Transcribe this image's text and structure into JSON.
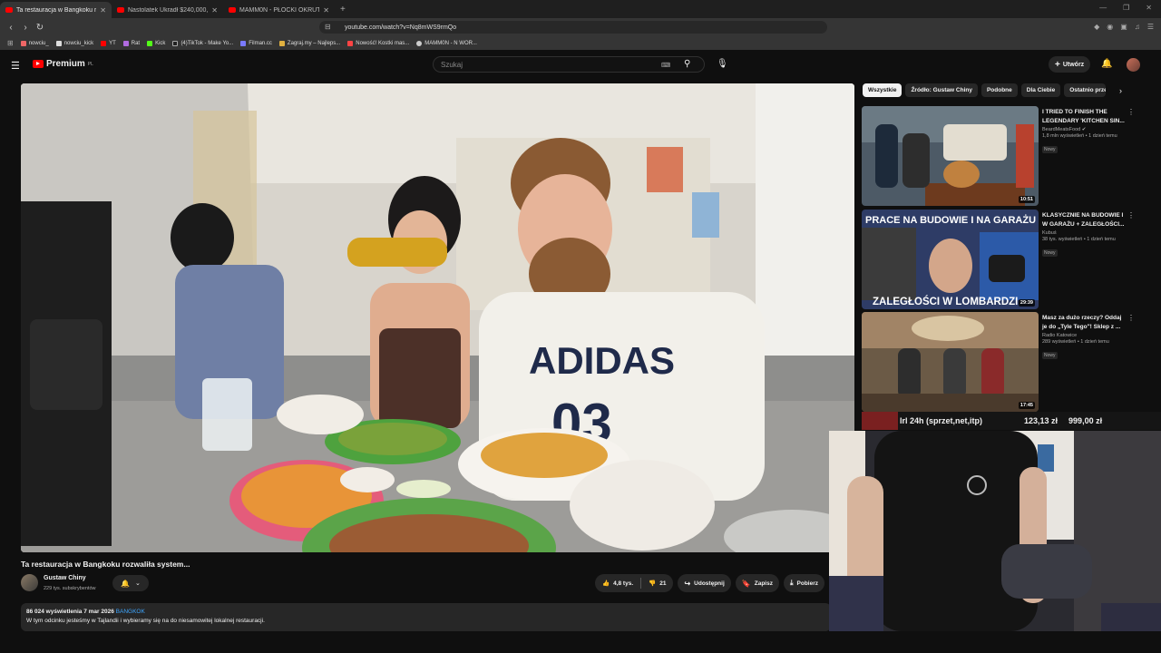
{
  "browser": {
    "tabs": [
      {
        "title": "Ta restauracja w Bangkoku ro",
        "active": true
      },
      {
        "title": "Nastolatek Ukradł $240,000,000 | Po",
        "active": false
      },
      {
        "title": "MAMM0N - PŁOCKI OKRUTNIK PUB",
        "active": false
      }
    ],
    "new_tab": "+",
    "url": "youtube.com/watch?v=Nq8mWS9rmQo",
    "bookmarks": [
      "nowciu_",
      "nowciu_kick",
      "YT",
      "Rat",
      "Kick",
      "(4)TikTok - Make Yo...",
      "Filman.cc",
      "Zagraj.my – Najleps...",
      "Nowość! Kostki mas...",
      "MAMM0N - N WOR..."
    ]
  },
  "youtube": {
    "logo": "Premium",
    "logo_region": "PL",
    "search_placeholder": "Szukaj",
    "create_label": "Utwórz"
  },
  "video": {
    "title": "Ta restauracja w Bangkoku rozwaliła system...",
    "channel": "Gustaw Chiny",
    "subscribers": "229 tys. subskrybentów",
    "likes": "4,8 tys.",
    "dislikes": "21",
    "share_label": "Udostępnij",
    "save_label": "Zapisz",
    "download_label": "Pobierz",
    "views_date": "86 024 wyświetlenia  7 mar 2026",
    "hashtag": "BANGKOK",
    "description": "W tym odcinku jesteśmy w Tajlandii i wybieramy się na do niesamowitej lokalnej restauracji."
  },
  "sidebar": {
    "chips": [
      "Wszystkie",
      "Źródło: Gustaw Chiny",
      "Podobne",
      "Dla Ciebie",
      "Ostatnio prze"
    ],
    "recommendations": [
      {
        "title": "I TRIED TO FINISH THE LEGENDARY 'KITCHEN SIN...",
        "channel": "BeardMeatsFood",
        "meta": "1,8 mln wyświetleń • 1 dzień temu",
        "badge": "Nowy",
        "duration": "10:51"
      },
      {
        "title": "KLASYCZNIE NA BUDOWIE I W GARAŻU + ZALEGŁOŚCI...",
        "channel": "Kubuś",
        "meta": "38 tys. wyświetleń • 1 dzień temu",
        "badge": "Nowy",
        "duration": "29:39",
        "thumb_top": "PRACE NA BUDOWIE I NA GARAŻU",
        "thumb_bottom": "ZALEGŁOŚCI W LOMBARDZI"
      },
      {
        "title": "Masz za dużo rzeczy? Oddaj je do „Tyle Tego\"! Sklep z ...",
        "channel": "Radio Katowice",
        "meta": "289 wyświetleń • 1 dzień temu",
        "badge": "Nowy",
        "duration": "17:45"
      }
    ]
  },
  "overlay": {
    "ticker_left": "lrl 24h (sprzet,net,itp)",
    "ticker_mid": "123,13 zł",
    "ticker_right": "999,00 zł"
  },
  "colors": {
    "brand": "#ff0000",
    "bg": "#0f0f0f",
    "link": "#3ea6ff"
  }
}
